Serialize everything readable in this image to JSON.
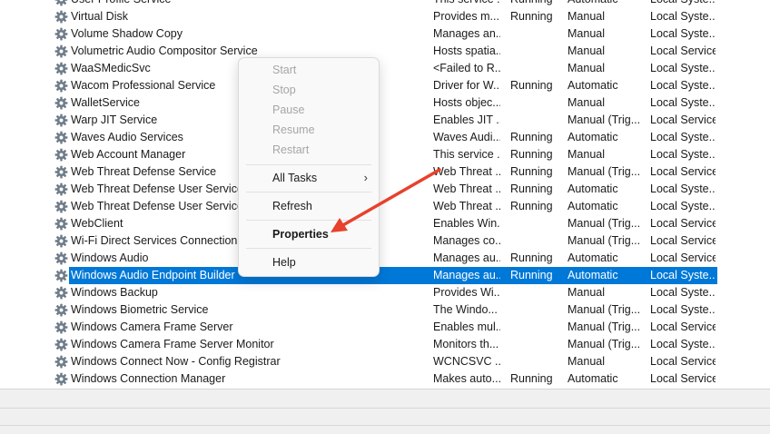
{
  "services": [
    {
      "name": "User Profile Service",
      "description": "This service ...",
      "status": "Running",
      "startup_type": "Automatic",
      "log_on_as": "Local Syste..."
    },
    {
      "name": "Virtual Disk",
      "description": "Provides m...",
      "status": "Running",
      "startup_type": "Manual",
      "log_on_as": "Local Syste..."
    },
    {
      "name": "Volume Shadow Copy",
      "description": "Manages an...",
      "status": "",
      "startup_type": "Manual",
      "log_on_as": "Local Syste..."
    },
    {
      "name": "Volumetric Audio Compositor Service",
      "description": "Hosts spatia...",
      "status": "",
      "startup_type": "Manual",
      "log_on_as": "Local Service"
    },
    {
      "name": "WaaSMedicSvc",
      "description": "<Failed to R...",
      "status": "",
      "startup_type": "Manual",
      "log_on_as": "Local Syste..."
    },
    {
      "name": "Wacom Professional Service",
      "description": "Driver for W...",
      "status": "Running",
      "startup_type": "Automatic",
      "log_on_as": "Local Syste..."
    },
    {
      "name": "WalletService",
      "description": "Hosts objec...",
      "status": "",
      "startup_type": "Manual",
      "log_on_as": "Local Syste..."
    },
    {
      "name": "Warp JIT Service",
      "description": "Enables JIT ...",
      "status": "",
      "startup_type": "Manual (Trig...",
      "log_on_as": "Local Service"
    },
    {
      "name": "Waves Audio Services",
      "description": "Waves Audi...",
      "status": "Running",
      "startup_type": "Automatic",
      "log_on_as": "Local Syste..."
    },
    {
      "name": "Web Account Manager",
      "description": "This service ...",
      "status": "Running",
      "startup_type": "Manual",
      "log_on_as": "Local Syste..."
    },
    {
      "name": "Web Threat Defense Service",
      "description": "Web Threat ...",
      "status": "Running",
      "startup_type": "Manual (Trig...",
      "log_on_as": "Local Service"
    },
    {
      "name": "Web Threat Defense User Service_6",
      "description": "Web Threat ...",
      "status": "Running",
      "startup_type": "Automatic",
      "log_on_as": "Local Syste..."
    },
    {
      "name": "Web Threat Defense User Service_9",
      "description": "Web Threat ...",
      "status": "Running",
      "startup_type": "Automatic",
      "log_on_as": "Local Syste..."
    },
    {
      "name": "WebClient",
      "description": "Enables Win...",
      "status": "",
      "startup_type": "Manual (Trig...",
      "log_on_as": "Local Service"
    },
    {
      "name": "Wi-Fi Direct Services Connection M",
      "description": "Manages co...",
      "status": "",
      "startup_type": "Manual (Trig...",
      "log_on_as": "Local Service"
    },
    {
      "name": "Windows Audio",
      "description": "Manages au...",
      "status": "Running",
      "startup_type": "Automatic",
      "log_on_as": "Local Service"
    },
    {
      "name": "Windows Audio Endpoint Builder",
      "description": "Manages au...",
      "status": "Running",
      "startup_type": "Automatic",
      "log_on_as": "Local Syste..."
    },
    {
      "name": "Windows Backup",
      "description": "Provides Wi...",
      "status": "",
      "startup_type": "Manual",
      "log_on_as": "Local Syste..."
    },
    {
      "name": "Windows Biometric Service",
      "description": "The Windo...",
      "status": "",
      "startup_type": "Manual (Trig...",
      "log_on_as": "Local Syste..."
    },
    {
      "name": "Windows Camera Frame Server",
      "description": "Enables mul...",
      "status": "",
      "startup_type": "Manual (Trig...",
      "log_on_as": "Local Service"
    },
    {
      "name": "Windows Camera Frame Server Monitor",
      "description": "Monitors th...",
      "status": "",
      "startup_type": "Manual (Trig...",
      "log_on_as": "Local Syste..."
    },
    {
      "name": "Windows Connect Now - Config Registrar",
      "description": "WCNCSVC ...",
      "status": "",
      "startup_type": "Manual",
      "log_on_as": "Local Service"
    },
    {
      "name": "Windows Connection Manager",
      "description": "Makes auto...",
      "status": "Running",
      "startup_type": "Automatic",
      "log_on_as": "Local Service"
    }
  ],
  "selected_service": "Windows Audio Endpoint Builder",
  "service_icon": "gear-icon",
  "context_menu": {
    "start": "Start",
    "stop": "Stop",
    "pause": "Pause",
    "resume": "Resume",
    "restart": "Restart",
    "all_tasks": "All Tasks",
    "refresh": "Refresh",
    "properties": "Properties",
    "help": "Help",
    "submenu_icon": "chevron-right-icon"
  },
  "colors": {
    "selection": "#0078d7",
    "annotation_arrow": "#e8412c",
    "disabled_text": "#a6a6a6"
  }
}
